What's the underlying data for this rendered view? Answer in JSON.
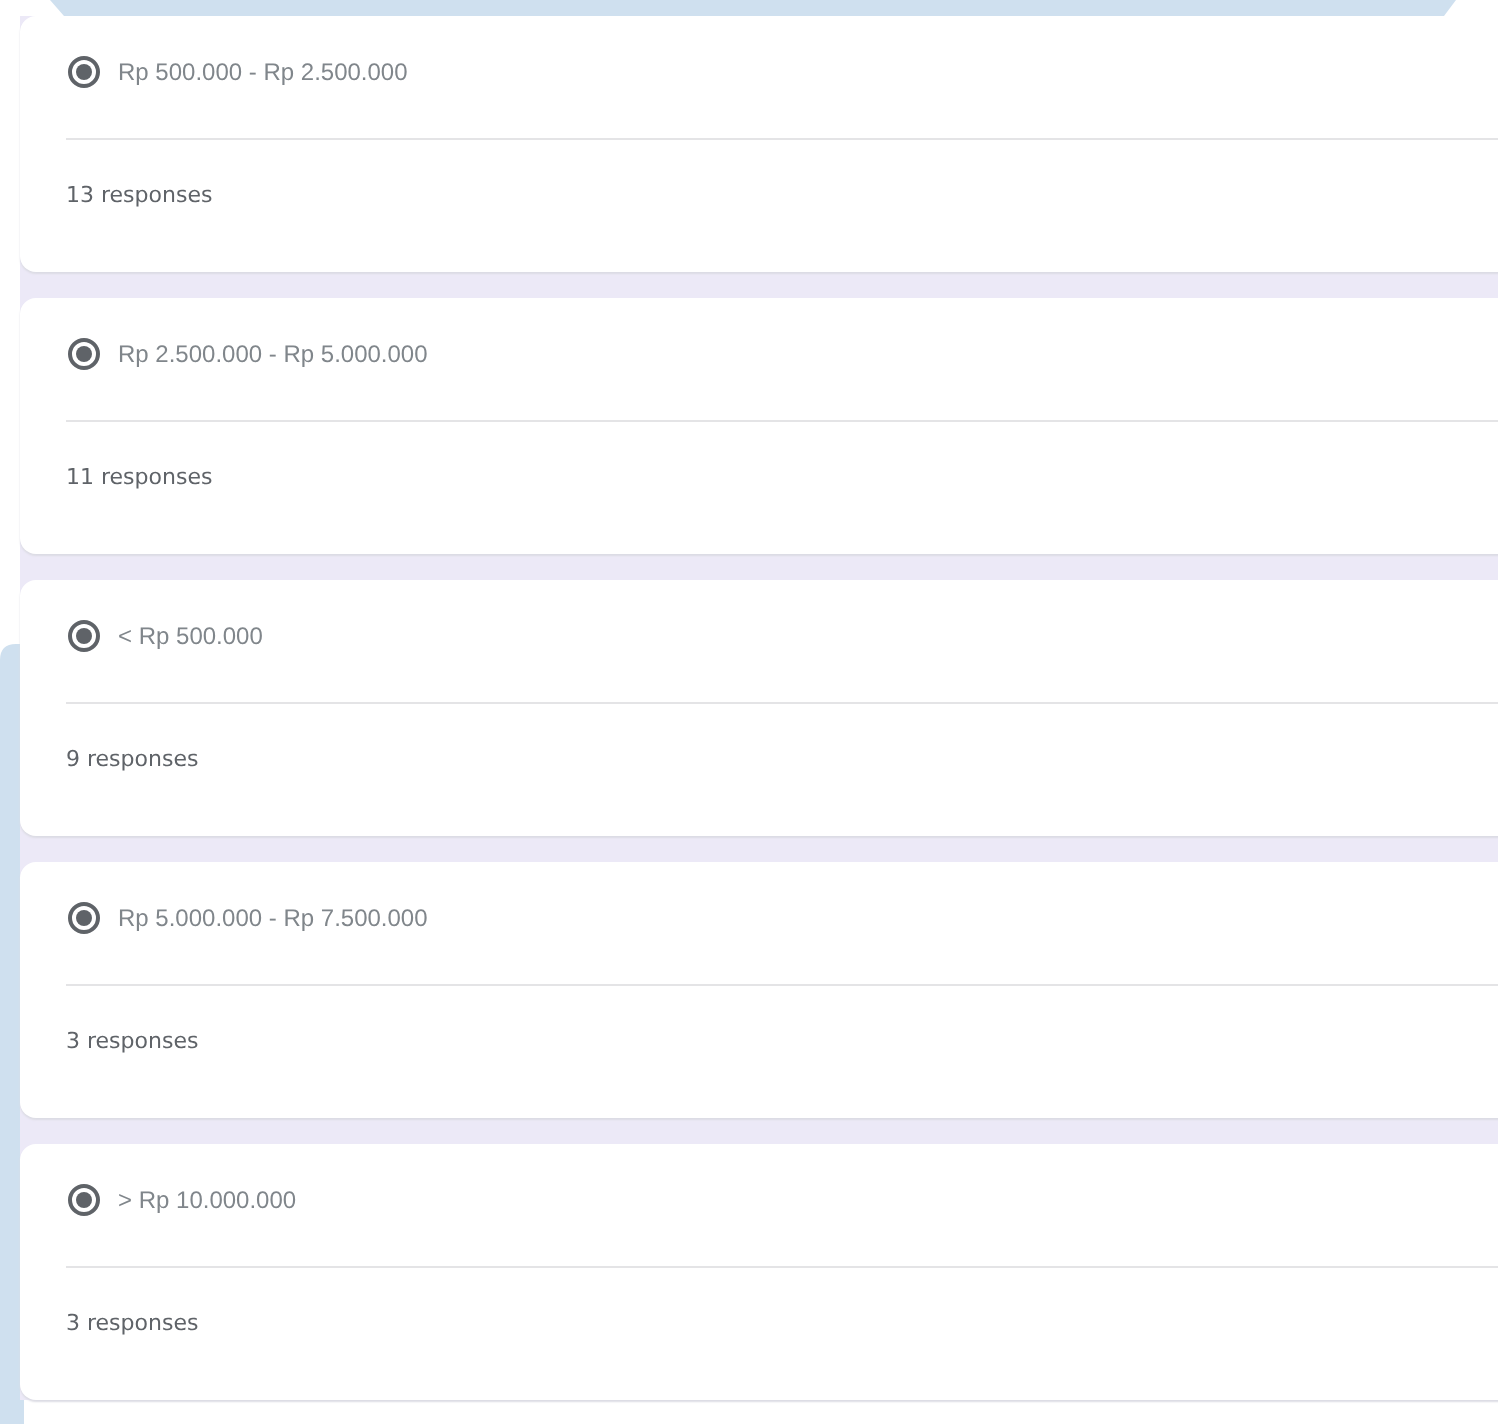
{
  "options": [
    {
      "label": "Rp 500.000 - Rp 2.500.000",
      "selected": true,
      "responses": "13 responses"
    },
    {
      "label": "Rp 2.500.000 - Rp 5.000.000",
      "selected": true,
      "responses": "11 responses"
    },
    {
      "label": "< Rp 500.000",
      "selected": true,
      "responses": "9 responses"
    },
    {
      "label": "Rp 5.000.000 - Rp 7.500.000",
      "selected": true,
      "responses": "3 responses"
    },
    {
      "label": "> Rp 10.000.000",
      "selected": true,
      "responses": "3 responses"
    }
  ]
}
